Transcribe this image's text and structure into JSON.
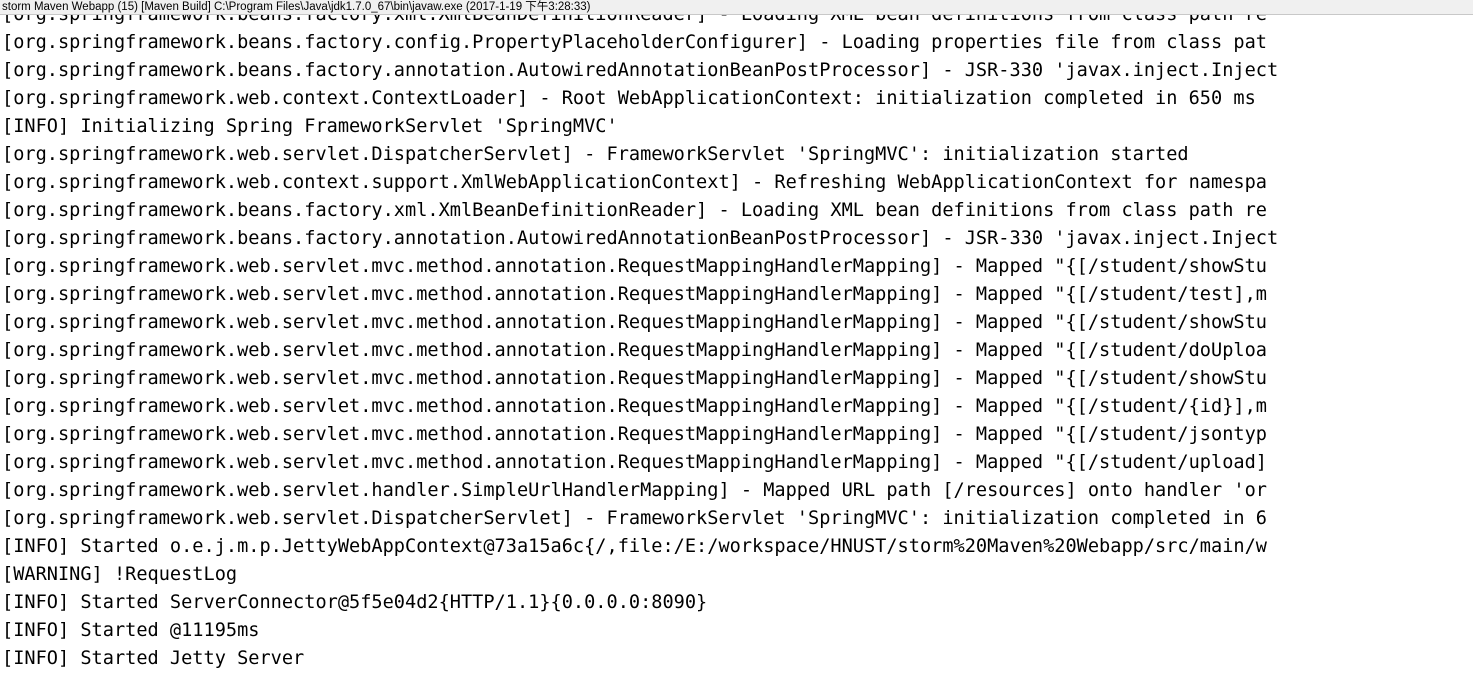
{
  "window": {
    "title": "storm Maven Webapp (15) [Maven Build] C:\\Program Files\\Java\\jdk1.7.0_67\\bin\\javaw.exe (2017-1-19 下午3:28:33)",
    "background_color": "#ffffff",
    "titlebar_color": "#f0f0f0",
    "text_color": "#000000"
  },
  "console": {
    "lines": [
      "[org.springframework.beans.factory.xml.XmlBeanDefinitionReader] - Loading XML bean definitions from class path re",
      "[org.springframework.beans.factory.config.PropertyPlaceholderConfigurer] - Loading properties file from class pat",
      "[org.springframework.beans.factory.annotation.AutowiredAnnotationBeanPostProcessor] - JSR-330 'javax.inject.Inject",
      "[org.springframework.web.context.ContextLoader] - Root WebApplicationContext: initialization completed in 650 ms",
      "[INFO] Initializing Spring FrameworkServlet 'SpringMVC'",
      "[org.springframework.web.servlet.DispatcherServlet] - FrameworkServlet 'SpringMVC': initialization started",
      "[org.springframework.web.context.support.XmlWebApplicationContext] - Refreshing WebApplicationContext for namespa",
      "[org.springframework.beans.factory.xml.XmlBeanDefinitionReader] - Loading XML bean definitions from class path re",
      "[org.springframework.beans.factory.annotation.AutowiredAnnotationBeanPostProcessor] - JSR-330 'javax.inject.Inject",
      "[org.springframework.web.servlet.mvc.method.annotation.RequestMappingHandlerMapping] - Mapped \"{[/student/showStu",
      "[org.springframework.web.servlet.mvc.method.annotation.RequestMappingHandlerMapping] - Mapped \"{[/student/test],m",
      "[org.springframework.web.servlet.mvc.method.annotation.RequestMappingHandlerMapping] - Mapped \"{[/student/showStu",
      "[org.springframework.web.servlet.mvc.method.annotation.RequestMappingHandlerMapping] - Mapped \"{[/student/doUploa",
      "[org.springframework.web.servlet.mvc.method.annotation.RequestMappingHandlerMapping] - Mapped \"{[/student/showStu",
      "[org.springframework.web.servlet.mvc.method.annotation.RequestMappingHandlerMapping] - Mapped \"{[/student/{id}],m",
      "[org.springframework.web.servlet.mvc.method.annotation.RequestMappingHandlerMapping] - Mapped \"{[/student/jsontyp",
      "[org.springframework.web.servlet.mvc.method.annotation.RequestMappingHandlerMapping] - Mapped \"{[/student/upload]",
      "[org.springframework.web.servlet.handler.SimpleUrlHandlerMapping] - Mapped URL path [/resources] onto handler 'or",
      "[org.springframework.web.servlet.DispatcherServlet] - FrameworkServlet 'SpringMVC': initialization completed in 6",
      "[INFO] Started o.e.j.m.p.JettyWebAppContext@73a15a6c{/,file:/E:/workspace/HNUST/storm%20Maven%20Webapp/src/main/w",
      "[WARNING] !RequestLog",
      "[INFO] Started ServerConnector@5f5e04d2{HTTP/1.1}{0.0.0.0:8090}",
      "[INFO] Started @11195ms",
      "[INFO] Started Jetty Server"
    ]
  }
}
